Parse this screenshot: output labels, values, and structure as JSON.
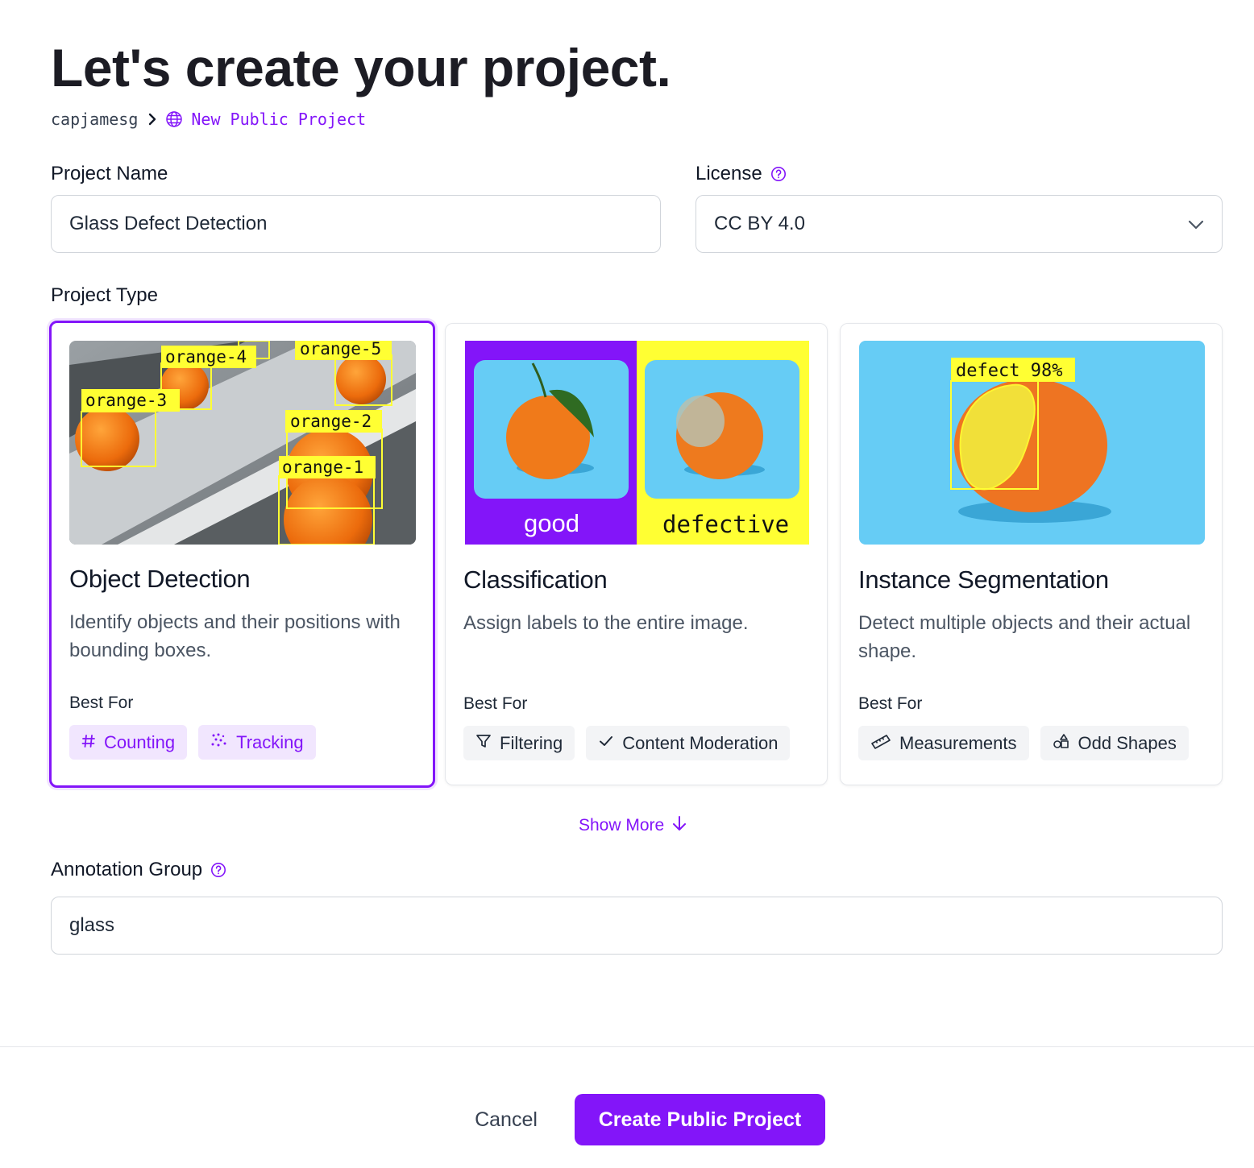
{
  "page": {
    "title": "Let's create your project."
  },
  "breadcrumb": {
    "owner": "capjamesg",
    "project": "New Public Project"
  },
  "project_name": {
    "label": "Project Name",
    "value": "Glass Defect Detection"
  },
  "license": {
    "label": "License",
    "value": "CC BY 4.0"
  },
  "project_type": {
    "label": "Project Type",
    "best_for_label": "Best For",
    "cards": [
      {
        "title": "Object Detection",
        "description": "Identify objects and their positions with bounding boxes.",
        "selected": true,
        "image_labels": [
          "orange-1",
          "orange-2",
          "orange-3",
          "orange-4",
          "orange-5"
        ],
        "tags": [
          {
            "label": "Counting",
            "icon": "hash-icon"
          },
          {
            "label": "Tracking",
            "icon": "sparkle-dots-icon"
          }
        ]
      },
      {
        "title": "Classification",
        "description": "Assign labels to the entire image.",
        "selected": false,
        "image_labels": [
          "good",
          "defective"
        ],
        "tags": [
          {
            "label": "Filtering",
            "icon": "funnel-icon"
          },
          {
            "label": "Content Moderation",
            "icon": "check-icon"
          }
        ]
      },
      {
        "title": "Instance Segmentation",
        "description": "Detect multiple objects and their actual shape.",
        "selected": false,
        "image_labels": [
          "defect 98%"
        ],
        "tags": [
          {
            "label": "Measurements",
            "icon": "ruler-icon"
          },
          {
            "label": "Odd Shapes",
            "icon": "shapes-icon"
          }
        ]
      }
    ]
  },
  "show_more": "Show More",
  "annotation_group": {
    "label": "Annotation Group",
    "value": "glass"
  },
  "footer": {
    "cancel": "Cancel",
    "create": "Create Public Project"
  },
  "colors": {
    "accent": "#8315f9",
    "accent_light": "#f1e6fe",
    "label_yellow": "#ffff33",
    "sky_blue": "#66ccf5"
  }
}
